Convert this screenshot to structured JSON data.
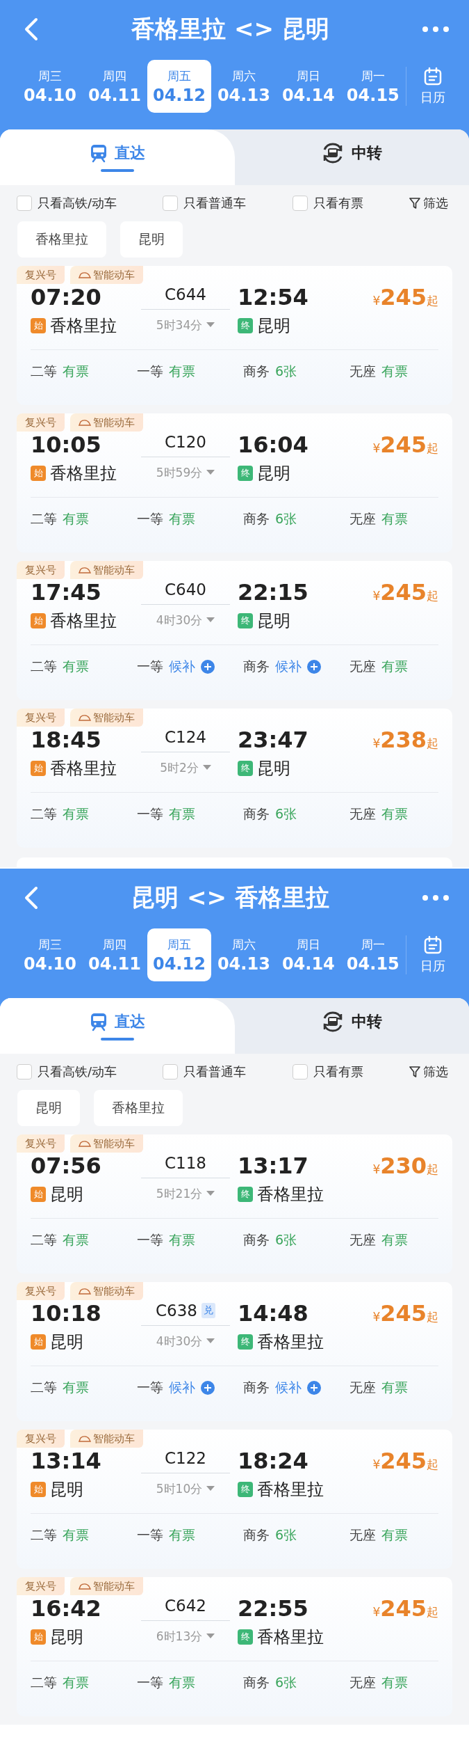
{
  "panels": [
    {
      "title": "香格里拉 <> 昆明",
      "calendar_label": "日历",
      "dates": [
        {
          "weekday": "周三",
          "date": "04.10",
          "selected": false
        },
        {
          "weekday": "周四",
          "date": "04.11",
          "selected": false
        },
        {
          "weekday": "周五",
          "date": "04.12",
          "selected": true
        },
        {
          "weekday": "周六",
          "date": "04.13",
          "selected": false
        },
        {
          "weekday": "周日",
          "date": "04.14",
          "selected": false
        },
        {
          "weekday": "周一",
          "date": "04.15",
          "selected": false
        }
      ],
      "tabs": [
        {
          "label": "直达",
          "kind": "direct",
          "selected": true
        },
        {
          "label": "中转",
          "kind": "transfer",
          "selected": false
        }
      ],
      "filters": [
        {
          "label": "只看高铁/动车",
          "checked": false
        },
        {
          "label": "只看普通车",
          "checked": false
        },
        {
          "label": "只看有票",
          "checked": false
        }
      ],
      "filter_button": "筛选",
      "stations": [
        "香格里拉",
        "昆明"
      ],
      "trains": [
        {
          "tags": [
            "复兴号",
            "智能动车"
          ],
          "depart": "07:20",
          "number": "C644",
          "arrive": "12:54",
          "start_badge": "始",
          "from": "香格里拉",
          "duration": "5时34分",
          "end_badge": "终",
          "to": "昆明",
          "currency": "¥",
          "price": "245",
          "price_suffix": "起",
          "seats": [
            {
              "class": "二等",
              "status": "有票",
              "kind": "available"
            },
            {
              "class": "一等",
              "status": "有票",
              "kind": "available"
            },
            {
              "class": "商务",
              "status": "6张",
              "kind": "available"
            },
            {
              "class": "无座",
              "status": "有票",
              "kind": "available"
            }
          ]
        },
        {
          "tags": [
            "复兴号",
            "智能动车"
          ],
          "depart": "10:05",
          "number": "C120",
          "arrive": "16:04",
          "start_badge": "始",
          "from": "香格里拉",
          "duration": "5时59分",
          "end_badge": "终",
          "to": "昆明",
          "currency": "¥",
          "price": "245",
          "price_suffix": "起",
          "seats": [
            {
              "class": "二等",
              "status": "有票",
              "kind": "available"
            },
            {
              "class": "一等",
              "status": "有票",
              "kind": "available"
            },
            {
              "class": "商务",
              "status": "6张",
              "kind": "available"
            },
            {
              "class": "无座",
              "status": "有票",
              "kind": "available"
            }
          ]
        },
        {
          "tags": [
            "复兴号",
            "智能动车"
          ],
          "depart": "17:45",
          "number": "C640",
          "arrive": "22:15",
          "start_badge": "始",
          "from": "香格里拉",
          "duration": "4时30分",
          "end_badge": "终",
          "to": "昆明",
          "currency": "¥",
          "price": "245",
          "price_suffix": "起",
          "seats": [
            {
              "class": "二等",
              "status": "有票",
              "kind": "available"
            },
            {
              "class": "一等",
              "status": "候补",
              "kind": "waitlist"
            },
            {
              "class": "商务",
              "status": "候补",
              "kind": "waitlist"
            },
            {
              "class": "无座",
              "status": "有票",
              "kind": "available"
            }
          ]
        },
        {
          "tags": [
            "复兴号",
            "智能动车"
          ],
          "depart": "18:45",
          "number": "C124",
          "arrive": "23:47",
          "start_badge": "始",
          "from": "香格里拉",
          "duration": "5时2分",
          "end_badge": "终",
          "to": "昆明",
          "currency": "¥",
          "price": "238",
          "price_suffix": "起",
          "seats": [
            {
              "class": "二等",
              "status": "有票",
              "kind": "available"
            },
            {
              "class": "一等",
              "status": "有票",
              "kind": "available"
            },
            {
              "class": "商务",
              "status": "6张",
              "kind": "available"
            },
            {
              "class": "无座",
              "status": "有票",
              "kind": "available"
            }
          ]
        }
      ],
      "more_below": true
    },
    {
      "title": "昆明 <> 香格里拉",
      "calendar_label": "日历",
      "dates": [
        {
          "weekday": "周三",
          "date": "04.10",
          "selected": false
        },
        {
          "weekday": "周四",
          "date": "04.11",
          "selected": false
        },
        {
          "weekday": "周五",
          "date": "04.12",
          "selected": true
        },
        {
          "weekday": "周六",
          "date": "04.13",
          "selected": false
        },
        {
          "weekday": "周日",
          "date": "04.14",
          "selected": false
        },
        {
          "weekday": "周一",
          "date": "04.15",
          "selected": false
        }
      ],
      "tabs": [
        {
          "label": "直达",
          "kind": "direct",
          "selected": true
        },
        {
          "label": "中转",
          "kind": "transfer",
          "selected": false
        }
      ],
      "filters": [
        {
          "label": "只看高铁/动车",
          "checked": false
        },
        {
          "label": "只看普通车",
          "checked": false
        },
        {
          "label": "只看有票",
          "checked": false
        }
      ],
      "filter_button": "筛选",
      "stations": [
        "昆明",
        "香格里拉"
      ],
      "trains": [
        {
          "tags": [
            "复兴号",
            "智能动车"
          ],
          "depart": "07:56",
          "number": "C118",
          "arrive": "13:17",
          "start_badge": "始",
          "from": "昆明",
          "duration": "5时21分",
          "end_badge": "终",
          "to": "香格里拉",
          "currency": "¥",
          "price": "230",
          "price_suffix": "起",
          "seats": [
            {
              "class": "二等",
              "status": "有票",
              "kind": "available"
            },
            {
              "class": "一等",
              "status": "有票",
              "kind": "available"
            },
            {
              "class": "商务",
              "status": "6张",
              "kind": "available"
            },
            {
              "class": "无座",
              "status": "有票",
              "kind": "available"
            }
          ]
        },
        {
          "tags": [
            "复兴号",
            "智能动车"
          ],
          "depart": "10:18",
          "number": "C638",
          "number_badge": "兑",
          "arrive": "14:48",
          "start_badge": "始",
          "from": "昆明",
          "duration": "4时30分",
          "end_badge": "终",
          "to": "香格里拉",
          "currency": "¥",
          "price": "245",
          "price_suffix": "起",
          "seats": [
            {
              "class": "二等",
              "status": "有票",
              "kind": "available"
            },
            {
              "class": "一等",
              "status": "候补",
              "kind": "waitlist"
            },
            {
              "class": "商务",
              "status": "候补",
              "kind": "waitlist"
            },
            {
              "class": "无座",
              "status": "有票",
              "kind": "available"
            }
          ]
        },
        {
          "tags": [
            "复兴号",
            "智能动车"
          ],
          "depart": "13:14",
          "number": "C122",
          "arrive": "18:24",
          "start_badge": "始",
          "from": "昆明",
          "duration": "5时10分",
          "end_badge": "终",
          "to": "香格里拉",
          "currency": "¥",
          "price": "245",
          "price_suffix": "起",
          "seats": [
            {
              "class": "二等",
              "status": "有票",
              "kind": "available"
            },
            {
              "class": "一等",
              "status": "有票",
              "kind": "available"
            },
            {
              "class": "商务",
              "status": "6张",
              "kind": "available"
            },
            {
              "class": "无座",
              "status": "有票",
              "kind": "available"
            }
          ]
        },
        {
          "tags": [
            "复兴号",
            "智能动车"
          ],
          "depart": "16:42",
          "number": "C642",
          "arrive": "22:55",
          "start_badge": "始",
          "from": "昆明",
          "duration": "6时13分",
          "end_badge": "终",
          "to": "香格里拉",
          "currency": "¥",
          "price": "245",
          "price_suffix": "起",
          "seats": [
            {
              "class": "二等",
              "status": "有票",
              "kind": "available"
            },
            {
              "class": "一等",
              "status": "有票",
              "kind": "available"
            },
            {
              "class": "商务",
              "status": "6张",
              "kind": "available"
            },
            {
              "class": "无座",
              "status": "有票",
              "kind": "available"
            }
          ]
        }
      ],
      "more_below": false
    }
  ]
}
